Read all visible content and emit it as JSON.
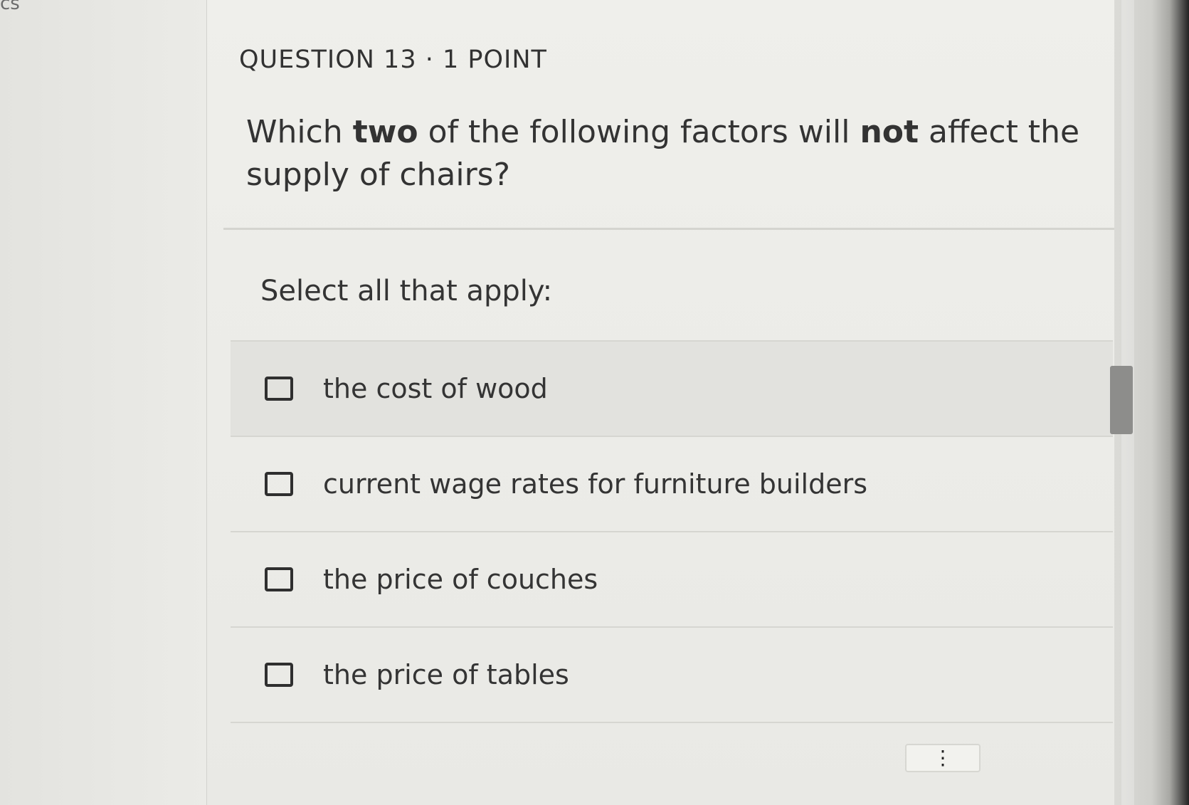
{
  "page": {
    "corner_fragment": "cs"
  },
  "question": {
    "header": "QUESTION 13 · 1 POINT",
    "prompt_parts": {
      "part1": "Which ",
      "bold1": "two",
      "part2": " of the following factors will ",
      "bold2": "not",
      "part3": " affect the supply of chairs?"
    },
    "instruction": "Select all that apply:",
    "options": [
      {
        "label": "the cost of wood",
        "checked": false
      },
      {
        "label": "current wage rates for furniture builders",
        "checked": false
      },
      {
        "label": "the price of couches",
        "checked": false
      },
      {
        "label": "the price of tables",
        "checked": false
      }
    ]
  },
  "controls": {
    "more_icon": "vertical-ellipsis-icon",
    "more_glyph": "⋮"
  },
  "colors": {
    "background": "#e7e7e3",
    "card": "#ecece8",
    "text": "#333333",
    "divider": "#d6d6d1",
    "scrollbar_thumb": "#8d8d8b"
  }
}
